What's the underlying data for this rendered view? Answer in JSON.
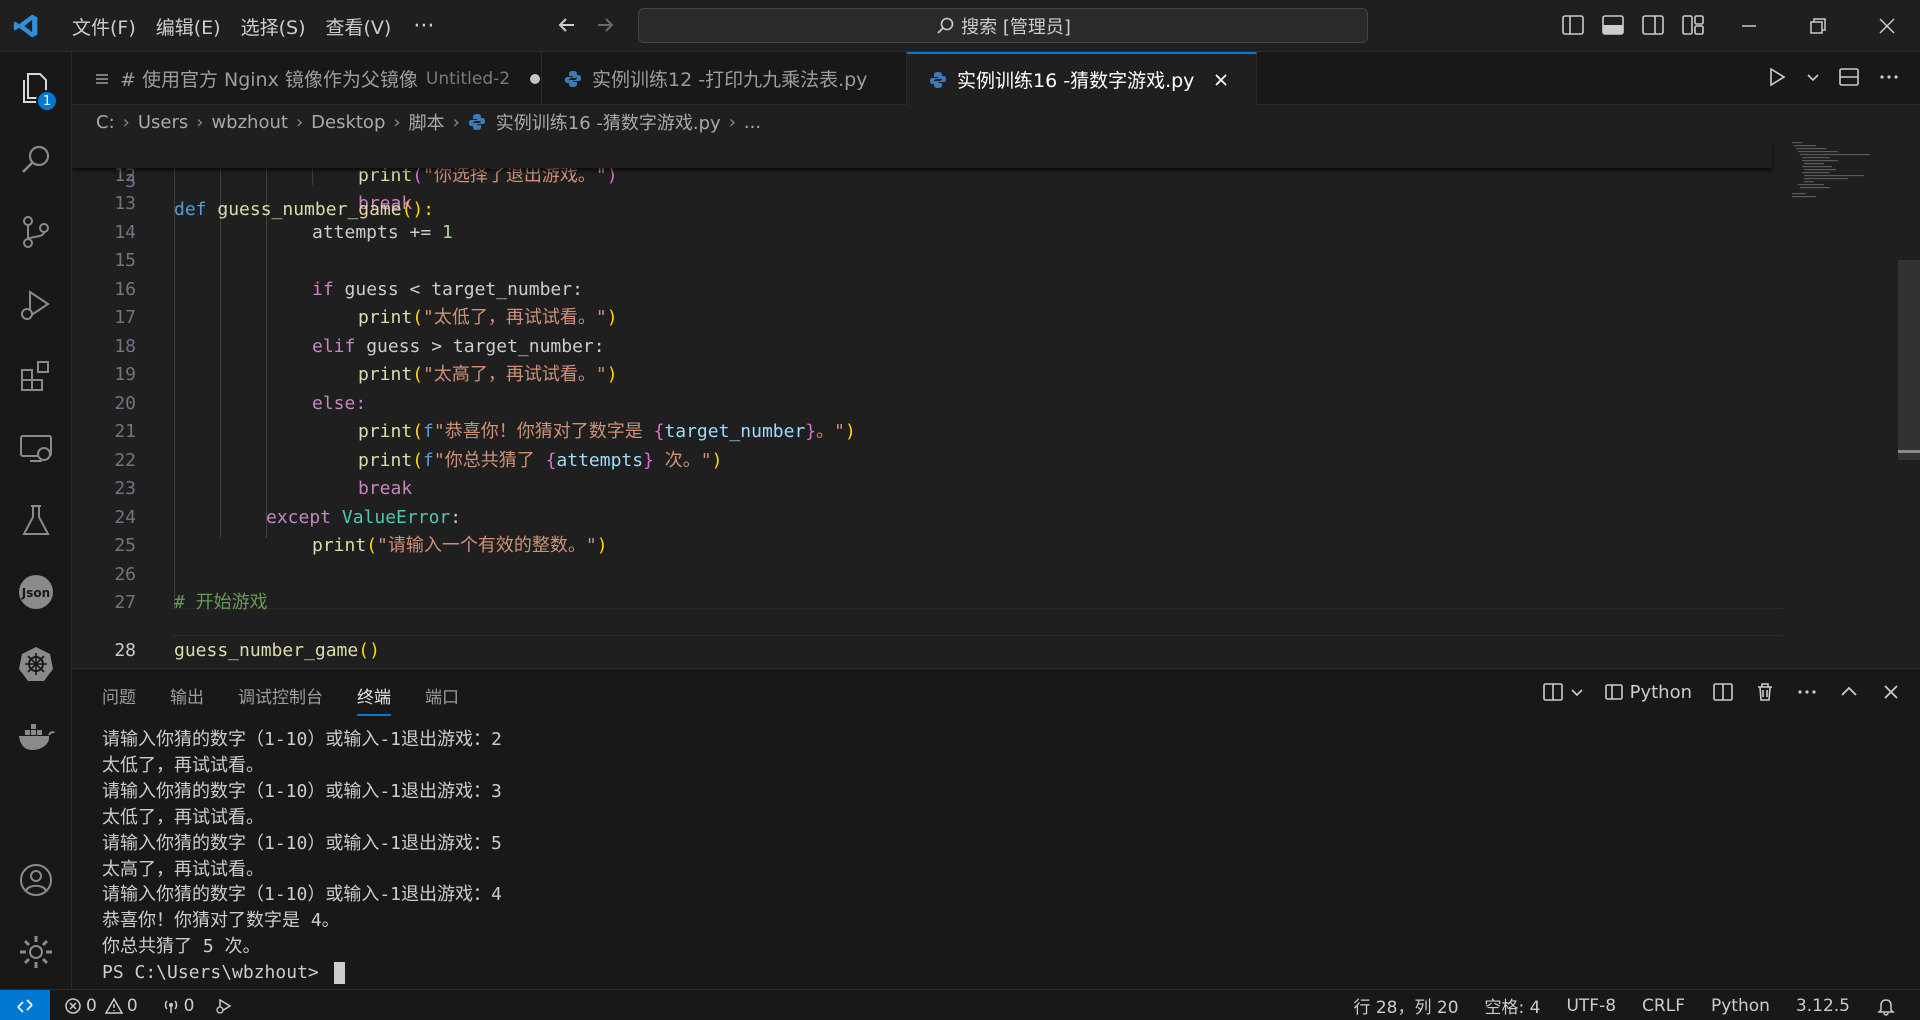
{
  "menus": [
    "文件(F)",
    "编辑(E)",
    "选择(S)",
    "查看(V)"
  ],
  "menu_more": "···",
  "search": {
    "text": "搜索 [管理员]"
  },
  "activity": {
    "explorer_badge": "1"
  },
  "tabs": [
    {
      "label": "# 使用官方 Nginx 镜像作为父镜像",
      "sub": "Untitled-2"
    },
    {
      "label": "实例训练12 -打印九九乘法表.py"
    },
    {
      "label": "实例训练16 -猜数字游戏.py"
    }
  ],
  "breadcrumb": [
    "C:",
    "Users",
    "wbzhout",
    "Desktop",
    "脚本",
    "实例训练16 -猜数字游戏.py",
    "..."
  ],
  "editor": {
    "sticky_ln": "3",
    "sticky_def": "def",
    "sticky_fn": "guess_number_game",
    "sticky_rest": "():",
    "peek": "print(\"你选择了退出游戏。\")",
    "lines": [
      "12",
      "13",
      "14",
      "15",
      "16",
      "17",
      "18",
      "19",
      "20",
      "21",
      "22",
      "23",
      "24",
      "25",
      "26",
      "27",
      "28"
    ],
    "kw_break": "break",
    "attempts_stmt": "attempts += ",
    "num_one": "1",
    "kw_if": "if",
    "kw_elif": "elif",
    "kw_else": "else:",
    "kw_except": "except",
    "cond_lt": " guess < target_number:",
    "cond_gt": " guess > target_number:",
    "fn_print": "print",
    "str_low": "\"太低了，再试试看。\"",
    "str_high": "\"太高了，再试试看。\"",
    "fstr_prefix": "f",
    "fstr1_a": "\"恭喜你！你猜对了数字是 ",
    "fstr1_var": "target_number",
    "fstr1_b": "。\"",
    "fstr2_a": "\"你总共猜了 ",
    "fstr2_var": "attempts",
    "fstr2_b": " 次。\"",
    "cls_valueerror": "ValueError",
    "colon": ":",
    "str_invalid": "\"请输入一个有效的整数。\"",
    "comment": "# 开始游戏",
    "call": "guess_number_game",
    "paren_open": "(",
    "paren_close": ")",
    "brace_open": "{",
    "brace_close": "}"
  },
  "panel": {
    "tabs": [
      "问题",
      "输出",
      "调试控制台",
      "终端",
      "端口"
    ],
    "active_tab": "终端",
    "terminal_label": "Python",
    "terminal_lines": [
      "请输入你猜的数字（1-10）或输入-1退出游戏：2",
      "太低了，再试试看。",
      "请输入你猜的数字（1-10）或输入-1退出游戏：3",
      "太低了，再试试看。",
      "请输入你猜的数字（1-10）或输入-1退出游戏：5",
      "太高了，再试试看。",
      "请输入你猜的数字（1-10）或输入-1退出游戏：4",
      "恭喜你！你猜对了数字是 4。",
      "你总共猜了 5 次。"
    ],
    "prompt": "PS C:\\Users\\wbzhout> "
  },
  "status": {
    "errors": "0",
    "warnings": "0",
    "ports": "0",
    "position": "行 28，列 20",
    "spaces": "空格: 4",
    "encoding": "UTF-8",
    "eol": "CRLF",
    "language": "Python",
    "python_version": "3.12.5"
  },
  "colors": {
    "accent": "#0078d4",
    "background": "#1f1f1f",
    "sidebar": "#181818"
  }
}
